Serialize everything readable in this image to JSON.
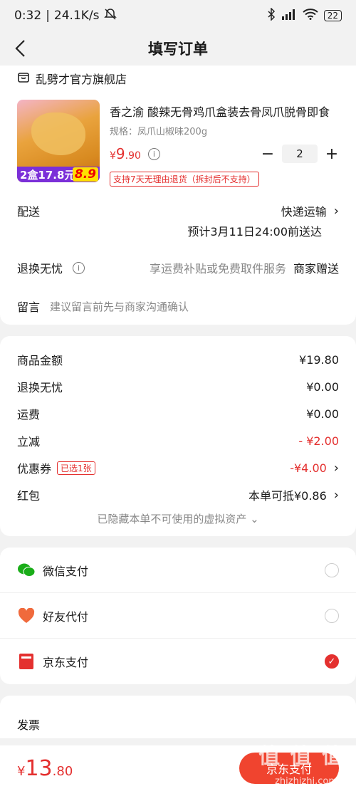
{
  "status": {
    "time": "0:32",
    "speed": "24.1K/s",
    "battery": "22"
  },
  "nav": {
    "title": "填写订单"
  },
  "shop": {
    "name": "乱劈才官方旗舰店"
  },
  "product": {
    "name": "香之渝 酸辣无骨鸡爪盒装去骨凤爪脱骨即食",
    "spec": "规格：凤爪山椒味200g",
    "price_symbol": "¥",
    "price_int": "9",
    "price_dec": ".90",
    "qty": "2",
    "promo": "2盒17.8元",
    "promo_big": "8.9",
    "return_tag": "支持7天无理由退货（拆封后不支持）"
  },
  "delivery": {
    "label": "配送",
    "method": "快递运输",
    "eta": "预计3月11日24:00前送达"
  },
  "return_service": {
    "label": "退换无忧",
    "desc": "享运费补贴或免费取件服务",
    "provider": "商家赠送"
  },
  "message": {
    "label": "留言",
    "placeholder": "建议留言前先与商家沟通确认"
  },
  "summary": {
    "goods_label": "商品金额",
    "goods_value": "¥19.80",
    "return_label": "退换无忧",
    "return_value": "¥0.00",
    "shipping_label": "运费",
    "shipping_value": "¥0.00",
    "discount_label": "立减",
    "discount_value": "- ¥2.00",
    "coupon_label": "优惠券",
    "coupon_badge": "已选1张",
    "coupon_value": "-¥4.00",
    "redpack_label": "红包",
    "redpack_value": "本单可抵¥0.86",
    "hidden_note": "已隐藏本单不可使用的虚拟资产"
  },
  "payment": {
    "wechat": "微信支付",
    "friend": "好友代付",
    "jd": "京东支付"
  },
  "invoice": {
    "label": "发票"
  },
  "bottom": {
    "symbol": "¥",
    "total_int": "13",
    "total_dec": ".80",
    "submit": "京东支付"
  },
  "watermark": {
    "main": "值 值 值",
    "sub": "zhizhizhi.com"
  },
  "colors": {
    "accent": "#e4302f",
    "wechat": "#1aad19"
  }
}
